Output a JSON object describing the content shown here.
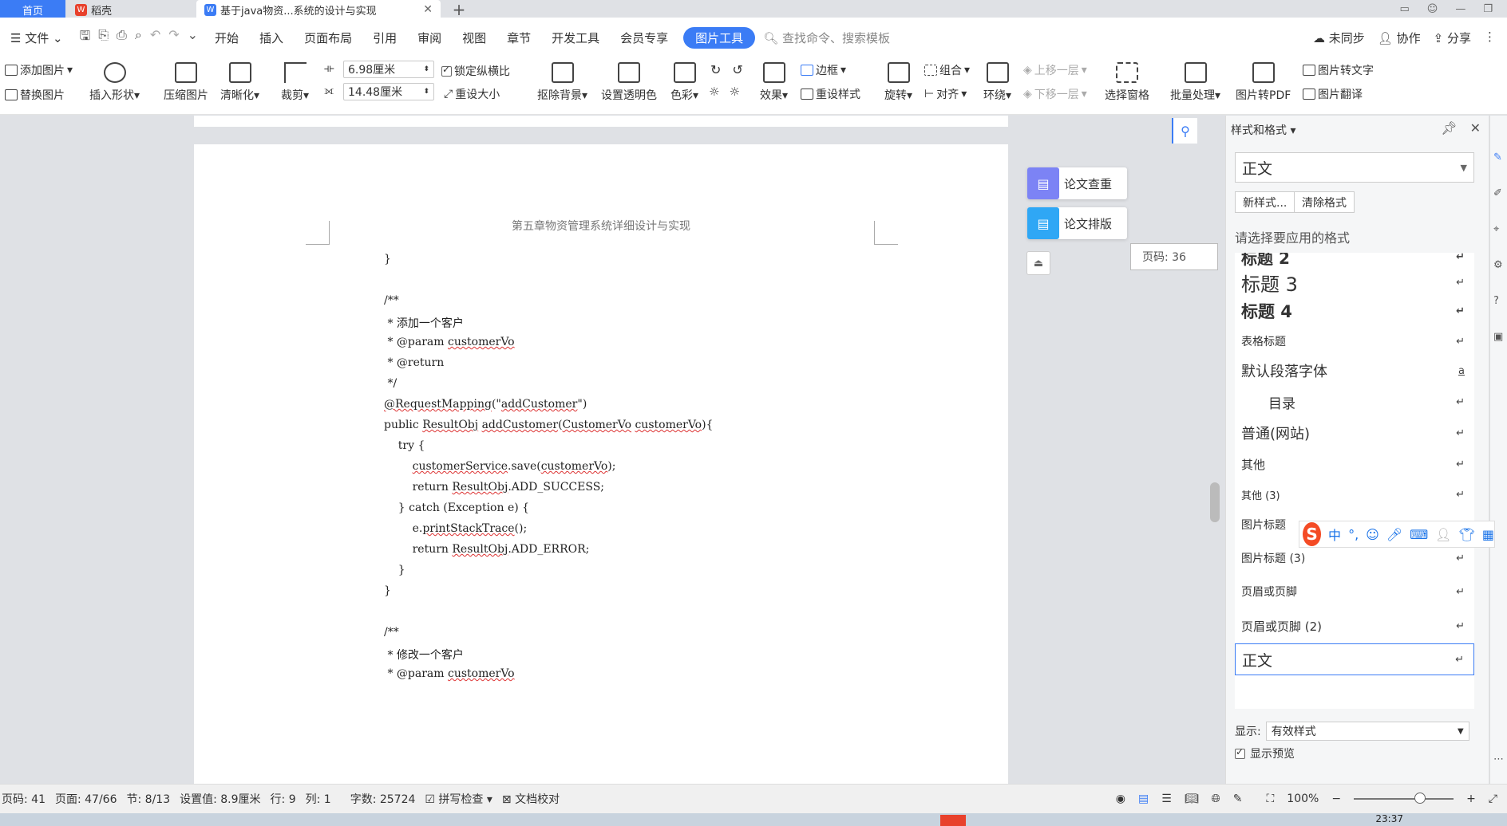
{
  "tabs": {
    "home": "首页",
    "daoke": "稻壳",
    "doc": "基于java物资...系统的设计与实现"
  },
  "menu": {
    "file": "文件",
    "items": [
      "开始",
      "插入",
      "页面布局",
      "引用",
      "审阅",
      "视图",
      "章节",
      "开发工具",
      "会员专享"
    ],
    "active": "图片工具",
    "search": "查找命令、搜索模板",
    "unsync": "未同步",
    "collab": "协作",
    "share": "分享"
  },
  "ribbon": {
    "add_image": "添加图片",
    "replace_image": "替换图片",
    "insert_shape": "插入形状",
    "compress": "压缩图片",
    "sharpen": "清晰化",
    "crop": "裁剪",
    "width": "6.98厘米",
    "height": "14.48厘米",
    "lock_ratio": "锁定纵横比",
    "reset_size": "重设大小",
    "remove_bg": "抠除背景",
    "set_transparent": "设置透明色",
    "color": "色彩",
    "effects": "效果",
    "border": "边框",
    "reset_style": "重设样式",
    "rotate": "旋转",
    "group": "组合",
    "align": "对齐",
    "wrap": "环绕",
    "bring_forward": "上移一层",
    "send_backward": "下移一层",
    "selection_pane": "选择窗格",
    "batch": "批量处理",
    "to_pdf": "图片转PDF",
    "to_text": "图片转文字",
    "translate": "图片翻译"
  },
  "document": {
    "header": "第五章物资管理系统详细设计与实现",
    "page_tip": "页码: 36"
  },
  "floating": {
    "check": "论文查重",
    "layout": "论文排版"
  },
  "styles_panel": {
    "title": "样式和格式",
    "current": "正文",
    "new_style": "新样式...",
    "clear_format": "清除格式",
    "hint": "请选择要应用的格式",
    "items": [
      "标题 2",
      "标题 3",
      "标题 4",
      "表格标题",
      "默认段落字体",
      "目录",
      "普通(网站)",
      "其他",
      "其他 (3)",
      "图片标题",
      "图片标题 (3)",
      "页眉或页脚",
      "页眉或页脚 (2)",
      "正文"
    ],
    "show_label": "显示:",
    "show_value": "有效样式",
    "show_preview": "显示预览"
  },
  "ime": {
    "mode": "中"
  },
  "status": {
    "page_no": "页码: 41",
    "pages": "页面: 47/66",
    "section": "节: 8/13",
    "setting": "设置值: 8.9厘米",
    "row": "行: 9",
    "col": "列: 1",
    "words": "字数: 25724",
    "spell": "拼写检查",
    "proof": "文档校对",
    "zoom": "100%",
    "zoom_level": 0.66
  },
  "clock": "23:37",
  "colors": {
    "accent": "#3b7cf5",
    "wps_red": "#e8412c"
  }
}
